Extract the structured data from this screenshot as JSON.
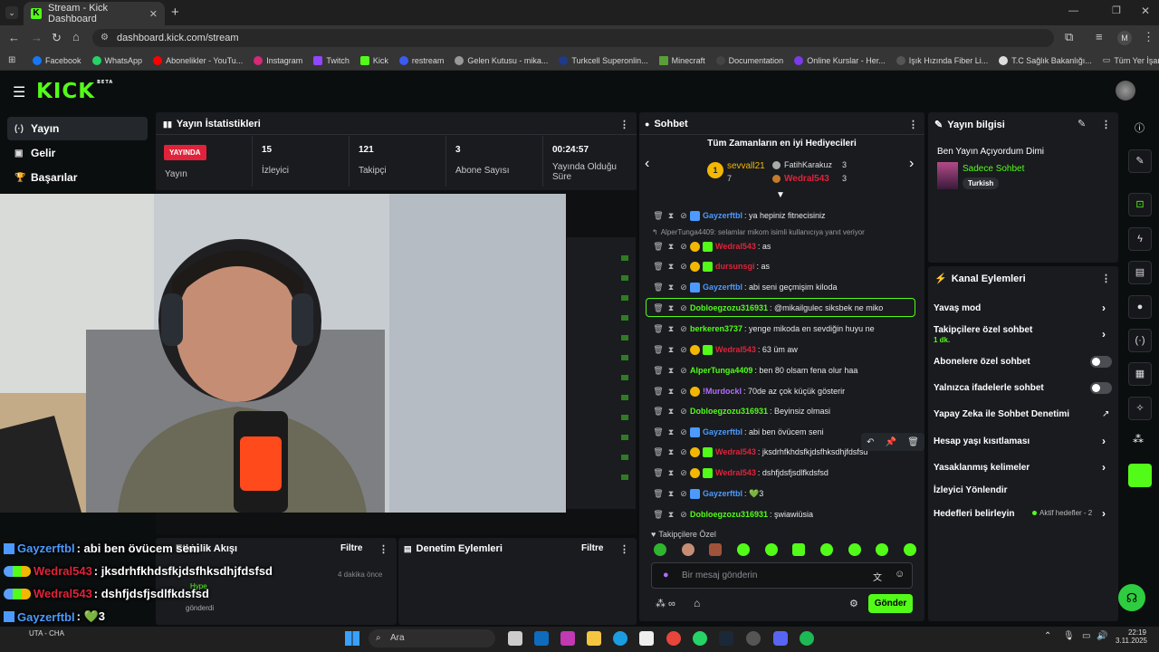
{
  "browser": {
    "tab_title": "Stream - Kick Dashboard",
    "url": "dashboard.kick.com/stream",
    "profile_initial": "M",
    "bookmarks": [
      "Facebook",
      "WhatsApp",
      "Abonelikler - YouTu...",
      "Instagram",
      "Twitch",
      "Kick",
      "restream",
      "Gelen Kutusu - mika...",
      "Turkcell Superonlin...",
      "Minecraft",
      "Documentation",
      "Online Kurslar - Her...",
      "Işık Hızında Fiber Li...",
      "T.C Sağlık Bakanlığı..."
    ],
    "all_bookmarks": "Tüm Yer İşaretleri"
  },
  "brand": {
    "logo": "KICK",
    "beta": "BETA"
  },
  "sidebar": {
    "items": [
      {
        "icon": "(·)",
        "label": "Yayın"
      },
      {
        "icon": "▣",
        "label": "Gelir"
      },
      {
        "icon": "🏆",
        "label": "Başarılar"
      }
    ]
  },
  "stats": {
    "title": "Yayın İstatistikleri",
    "live_badge": "YAYINDA",
    "live_label": "Yayın",
    "viewers": {
      "value": "15",
      "label": "İzleyici"
    },
    "followers": {
      "value": "121",
      "label": "Takipçi"
    },
    "subs": {
      "value": "3",
      "label": "Abone Sayısı"
    },
    "uptime": {
      "value": "00:24:57",
      "label": "Yayında Olduğu Süre"
    }
  },
  "activity": {
    "title": "Etkinlik Akışı",
    "filter": "Filtre",
    "time": "4 dakika önce",
    "hype": "Hype",
    "sent": "gönderdi"
  },
  "moderation": {
    "title": "Denetim Eylemleri",
    "filter": "Filtre"
  },
  "chat": {
    "title": "Sohbet",
    "gifters_title": "Tüm Zamanların en iyi Hediyecileri",
    "top_gifter": {
      "name": "sevvall21",
      "count": "7",
      "rank": "1"
    },
    "gifter2": {
      "name": "FatihKarakuz",
      "count": "3"
    },
    "gifter3": {
      "name": "Wedral543",
      "count": "3"
    },
    "reply_note": "AlperTunga4409: selamlar mikom isimli kullanıcıya yanıt veriyor",
    "messages": [
      {
        "user": "Gayzerftbl",
        "text": ": ya hepiniz fitnecisiniz",
        "color": "#4c9aff"
      },
      {
        "user": "Wedral543",
        "text": ": as",
        "color": "#e0233a"
      },
      {
        "user": "dursunsgi",
        "text": ": as",
        "color": "#e0233a"
      },
      {
        "user": "Gayzerftbl",
        "text": ": abi seni geçmişim kiloda",
        "color": "#4c9aff"
      },
      {
        "user": "Dobloegzozu316931",
        "text": ": @mikailgulec siksbek ne miko",
        "color": "#53fc18"
      },
      {
        "user": "berkeren3737",
        "text": ": yenge mikoda en sevdiğin huyu ne",
        "color": "#53fc18"
      },
      {
        "user": "Wedral543",
        "text": ": 63 üm aw",
        "color": "#e0233a"
      },
      {
        "user": "AlperTunga4409",
        "text": ": ben 80 olsam fena olur haa",
        "color": "#53fc18"
      },
      {
        "user": "!Murdockl",
        "text": ": 70de az çok küçük gösterir",
        "color": "#b26cff"
      },
      {
        "user": "Dobloegzozu316931",
        "text": ": Beyinsiz olmasi",
        "color": "#53fc18"
      },
      {
        "user": "Gayzerftbl",
        "text": ": abi ben övücem seni",
        "color": "#4c9aff"
      },
      {
        "user": "Wedral543",
        "text": ": jksdrhfkhdsfkjdsfhksdhjfdsfsd",
        "color": "#e0233a"
      },
      {
        "user": "Wedral543",
        "text": ": dshfjdsfjsdlfkdsfsd",
        "color": "#e0233a"
      },
      {
        "user": "Gayzerftbl",
        "text": ": 💚3",
        "color": "#4c9aff"
      },
      {
        "user": "Dobloegzozu316931",
        "text": ": şwiawiüsia",
        "color": "#53fc18"
      }
    ],
    "followers_only": "Takipçilere Özel",
    "input_placeholder": "Bir mesaj gönderin",
    "send": "Gönder"
  },
  "stream_info": {
    "title": "Yayın bilgisi",
    "stream_title": "Ben Yayın Açıyordum Dimi",
    "category": "Sadece Sohbet",
    "language": "Turkish"
  },
  "channel_actions": {
    "title": "Kanal Eylemleri",
    "items": [
      {
        "label": "Yavaş mod"
      },
      {
        "label": "Takipçilere özel sohbet",
        "sub": "1 dk."
      },
      {
        "label": "Abonelere özel sohbet"
      },
      {
        "label": "Yalnızca ifadelerle sohbet"
      },
      {
        "label": "Yapay Zeka ile Sohbet Denetimi"
      },
      {
        "label": "Hesap yaşı kısıtlaması"
      },
      {
        "label": "Yasaklanmış kelimeler"
      },
      {
        "label": "İzleyici Yönlendir"
      },
      {
        "label": "Hedefleri belirleyin",
        "sub": "Aktif hedefler - 2"
      }
    ]
  },
  "overlay_chat": [
    {
      "user": "Gayzerftbl",
      "text": ": abi ben övücem seni",
      "color": "#4c9aff"
    },
    {
      "user": "Wedral543",
      "text": ": jksdrhfkhdsfkjdsfhksdhjfdsfsd",
      "color": "#e0233a"
    },
    {
      "user": "Wedral543",
      "text": ": dshfjdsfjsdlfkdsfsd",
      "color": "#e0233a"
    },
    {
      "user": "Gayzerftbl",
      "text": ": 💚3",
      "color": "#4c9aff"
    },
    {
      "user": "Dobloegzozu316931",
      "text": ": şwiawiüsia",
      "color": "#53fc18"
    }
  ],
  "taskbar": {
    "weather": "UTA - CHA",
    "search": "Ara",
    "time": "22:19",
    "date": "3.11.2025"
  },
  "colors": {
    "brand": "#53fc18",
    "panel": "#191b1f",
    "live": "#e0233a"
  }
}
